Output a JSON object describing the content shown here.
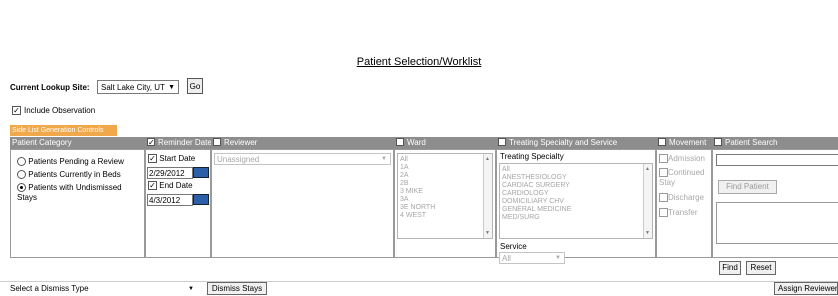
{
  "page": {
    "title": "Patient Selection/Worklist"
  },
  "lookup": {
    "label": "Current Lookup Site:",
    "site_value": "Salt Lake City, UT",
    "go_label": "Go",
    "include_observation_label": "Include Observation",
    "include_observation_checked": true
  },
  "panel": {
    "title": "Side List Generation Controls"
  },
  "category": {
    "header": "Patient Category",
    "options": [
      {
        "label": "Patients Pending a Review",
        "selected": false
      },
      {
        "label": "Patients Currently in Beds",
        "selected": false
      },
      {
        "label": "Patients with Undismissed Stays",
        "selected": true
      }
    ]
  },
  "reminder": {
    "header": "Reminder Date",
    "start_label": "Start Date",
    "start_value": "2/29/2012",
    "end_label": "End Date",
    "end_value": "4/3/2012"
  },
  "reviewer": {
    "header": "Reviewer",
    "value": "Unassigned"
  },
  "ward": {
    "header": "Ward",
    "items": [
      "All",
      "1A",
      "2A",
      "2B",
      "3 MIKE",
      "3A",
      "3E NORTH",
      "4 WEST"
    ]
  },
  "treating": {
    "header": "Treating Specialty and Service",
    "specialty_label": "Treating Specialty",
    "specialty_items": [
      "All",
      "ANESTHESIOLOGY",
      "CARDIAC SURGERY",
      "CARDIOLOGY",
      "DOMICILIARY CHV",
      "GENERAL MEDICINE",
      "MED/SURG"
    ],
    "service_label": "Service",
    "service_value": "All"
  },
  "movement": {
    "header": "Movement",
    "options": [
      "Admission",
      "Continued Stay",
      "Discharge",
      "Transfer"
    ]
  },
  "search": {
    "header": "Patient Search",
    "find_patient_label": "Find Patient",
    "find_label": "Find",
    "reset_label": "Reset"
  },
  "footer": {
    "dismiss_type_placeholder": "Select a Dismiss Type",
    "dismiss_button": "Dismiss Stays",
    "assign_button": "Assign Reviewer"
  }
}
